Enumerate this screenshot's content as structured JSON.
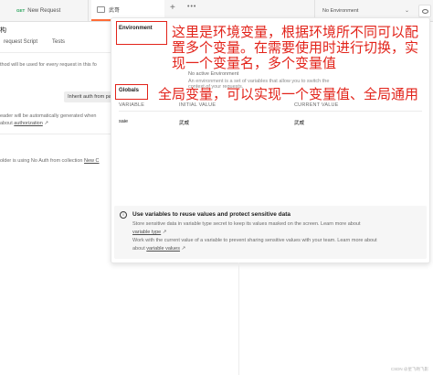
{
  "tabs": {
    "request": {
      "method": "GET",
      "label": "New Request"
    },
    "active": {
      "label": "武哥"
    },
    "plus": "+",
    "more": "•••"
  },
  "env_select": {
    "value": "No Environment",
    "chevron": "⌄"
  },
  "background": {
    "title": "构",
    "subtab_1": "request Script",
    "subtab_2": "Tests",
    "line_1": "thod will be used for every request in this fo",
    "inherit_button": "Inherit auth from pa",
    "line_2": "eader will be automatically generated when",
    "line_3_prefix": "about ",
    "line_3_link": "authorization",
    "line_3_suffix": " ↗",
    "line_4_prefix": "older is using No Auth from collection ",
    "line_4_link": "New C"
  },
  "popover": {
    "environment_label": "Environment",
    "no_active": "No active Environment",
    "env_desc_1": "An environment is a set of variables that allow you to switch the",
    "env_desc_2": "context of your requests.",
    "globals_label": "Globals",
    "table": {
      "headers": [
        "VARIABLE",
        "INITIAL VALUE",
        "CURRENT VALUE"
      ],
      "rows": [
        [
          "saie",
          "武威",
          "武威"
        ]
      ]
    },
    "info": {
      "icon": "i",
      "title": "Use variables to reuse values and protect sensitive data",
      "line_1": "Store sensitive data in variable type secret to keep its values masked on the screen. Learn more about",
      "line_2_link": "variable type",
      "line_2_suffix": " ↗",
      "line_3": "Work with the current value of a variable to prevent sharing sensitive values with your team. Learn more about",
      "line_4_link": "variable values",
      "line_4_suffix": " ↗"
    }
  },
  "annotations": {
    "environment": [
      "这里是环境变量，根据环境所不同可以配",
      "置多个变量。在需要使用时进行切换，实",
      "现一个变量名，多个变量值"
    ],
    "globals": "全局变量，可以实现一个变量值、全局通用",
    "color": "#e2231a"
  },
  "watermark": "CSDN @星飞吻飞影"
}
